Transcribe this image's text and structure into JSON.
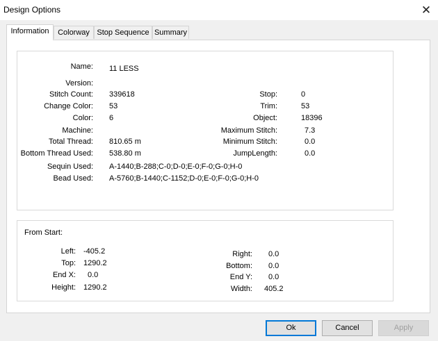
{
  "window": {
    "title": "Design Options",
    "close_symbol": "✕"
  },
  "tabs": [
    {
      "label": "Information",
      "active": true
    },
    {
      "label": "Colorway",
      "active": false
    },
    {
      "label": "Stop Sequence",
      "active": false
    },
    {
      "label": "Summary",
      "active": false
    }
  ],
  "info": {
    "name_label": "Name:",
    "name_value": "11 LESS",
    "version_label": "Version:",
    "version_value": "",
    "stitch_count_label": "Stitch Count:",
    "stitch_count_value": "339618",
    "change_color_label": "Change Color:",
    "change_color_value": "53",
    "color_label": "Color:",
    "color_value": "6",
    "machine_label": "Machine:",
    "machine_value": "",
    "total_thread_label": "Total Thread:",
    "total_thread_value": "810.65 m",
    "bottom_thread_label": "Bottom Thread Used:",
    "bottom_thread_value": "538.80 m",
    "sequin_label": "Sequin Used:",
    "sequin_value": "A-1440;B-288;C-0;D-0;E-0;F-0;G-0;H-0",
    "bead_label": "Bead Used:",
    "bead_value": "A-5760;B-1440;C-1152;D-0;E-0;F-0;G-0;H-0",
    "stop_label": "Stop:",
    "stop_value": "0",
    "trim_label": "Trim:",
    "trim_value": "53",
    "object_label": "Object:",
    "object_value": "18396",
    "max_stitch_label": "Maximum Stitch:",
    "max_stitch_value": "7.3",
    "min_stitch_label": "Minimum Stitch:",
    "min_stitch_value": "0.0",
    "jump_length_label": "JumpLength:",
    "jump_length_value": "0.0"
  },
  "from_start": {
    "heading": "From Start:",
    "left_label": "Left:",
    "left_value": "-405.2",
    "top_label": "Top:",
    "top_value": "1290.2",
    "end_x_label": "End X:",
    "end_x_value": "0.0",
    "height_label": "Height:",
    "height_value": "1290.2",
    "right_label": "Right:",
    "right_value": "0.0",
    "bottom_label": "Bottom:",
    "bottom_value": "0.0",
    "end_y_label": "End Y:",
    "end_y_value": "0.0",
    "width_label": "Width:",
    "width_value": "405.2"
  },
  "buttons": {
    "ok": "Ok",
    "cancel": "Cancel",
    "apply": "Apply"
  }
}
